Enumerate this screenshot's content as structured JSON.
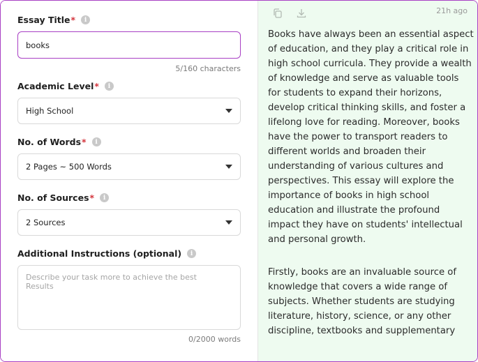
{
  "form": {
    "title_label": "Essay Title",
    "title_value": "books",
    "title_counter": "5/160 characters",
    "level_label": "Academic Level",
    "level_value": "High School",
    "words_label": "No. of Words",
    "words_value": "2 Pages ~ 500 Words",
    "sources_label": "No. of Sources",
    "sources_value": "2 Sources",
    "instructions_label": "Additional Instructions (optional)",
    "instructions_placeholder": "Describe your task more to achieve the best\nResults",
    "instructions_counter": "0/2000 words",
    "required_mark": "*",
    "info_glyph": "i"
  },
  "output": {
    "timestamp": "21h ago",
    "icons": [
      "copy-icon",
      "download-icon"
    ],
    "paragraphs": [
      "Books have always been an essential aspect of education, and they play a critical role in high school curricula. They provide a wealth of knowledge and serve as valuable tools for students to expand their horizons, develop critical thinking skills, and foster a lifelong love for reading. Moreover, books have the power to transport readers to different worlds and broaden their understanding of various cultures and perspectives. This essay will explore the importance of books in high school education and illustrate the profound impact they have on students' intellectual and personal growth.",
      "Firstly, books are an invaluable source of knowledge that covers a wide range of subjects. Whether students are studying literature, history, science, or any other discipline, textbooks and supplementary"
    ]
  },
  "colors": {
    "accent": "#a83fc4",
    "required": "#d3333b",
    "output_bg": "#eefbf0"
  }
}
